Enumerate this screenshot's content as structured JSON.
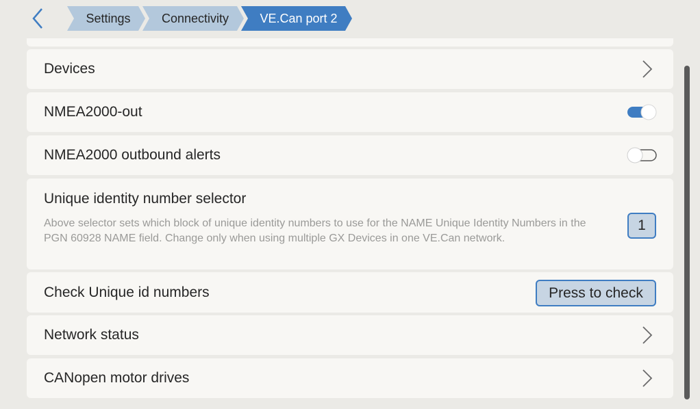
{
  "header": {
    "breadcrumbs": [
      "Settings",
      "Connectivity",
      "VE.Can port 2"
    ]
  },
  "rows": {
    "devices": {
      "label": "Devices"
    },
    "nmea_out": {
      "label": "NMEA2000-out",
      "enabled": true
    },
    "nmea_alerts": {
      "label": "NMEA2000 outbound alerts",
      "enabled": false
    },
    "unique_selector": {
      "label": "Unique identity number selector",
      "description": "Above selector sets which block of unique identity numbers to use for the NAME Unique Identity Numbers in the PGN 60928 NAME field. Change only when using multiple GX Devices in one VE.Can network.",
      "value": "1"
    },
    "check_ids": {
      "label": "Check Unique id numbers",
      "button": "Press to check"
    },
    "network_status": {
      "label": "Network status"
    },
    "canopen": {
      "label": "CANopen motor drives"
    }
  },
  "colors": {
    "accent": "#3f7dc2",
    "crumb_inactive": "#b3c8dc",
    "row_bg": "#f8f7f4",
    "page_bg": "#ebeae6"
  },
  "icons": [
    "back-icon",
    "chevron-right-icon",
    "toggle-switch-icon"
  ]
}
